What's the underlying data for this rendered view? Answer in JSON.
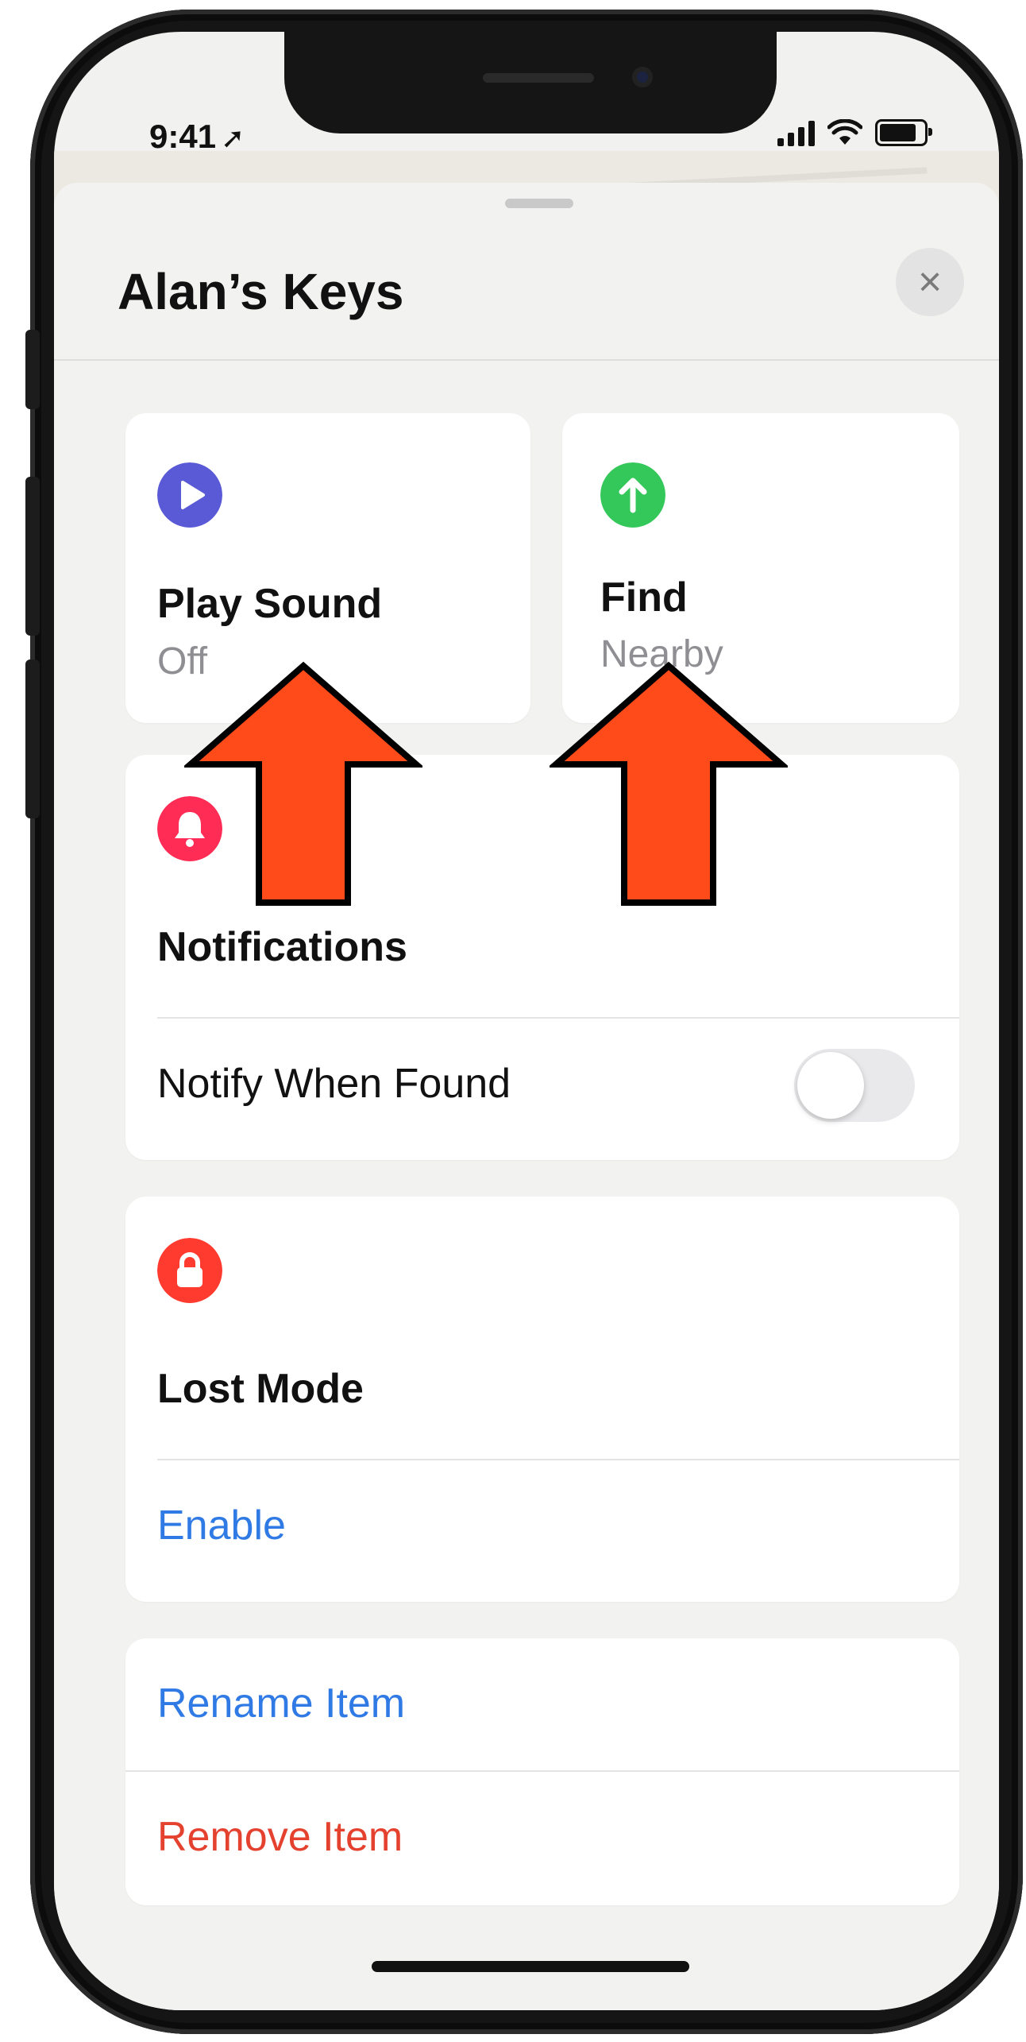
{
  "status_bar": {
    "time": "9:41"
  },
  "sheet": {
    "title": "Alan’s Keys",
    "close_label": "×"
  },
  "actions": [
    {
      "title": "Play Sound",
      "subtitle": "Off",
      "color": "#5a5ad6"
    },
    {
      "title": "Find",
      "subtitle": "Nearby",
      "color": "#34c759"
    }
  ],
  "notifications": {
    "title": "Notifications",
    "color": "#ff2d55",
    "rows": [
      {
        "label": "Notify When Found",
        "toggle_on": false
      }
    ]
  },
  "lost_mode": {
    "title": "Lost Mode",
    "color": "#ff3b30",
    "action_label": "Enable"
  },
  "item_actions": {
    "rename_label": "Rename Item",
    "remove_label": "Remove Item"
  },
  "colors": {
    "accent_blue": "#2f7ae5",
    "destructive_red": "#e5412f",
    "annotation_arrow": "#ff4a1a"
  }
}
